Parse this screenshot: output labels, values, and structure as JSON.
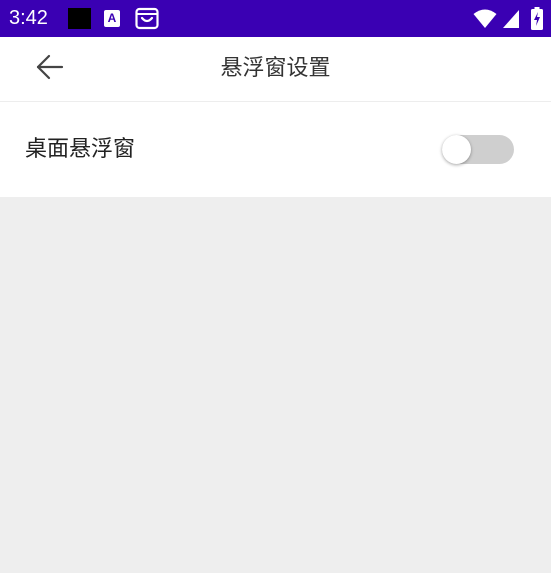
{
  "status_bar": {
    "time": "3:42",
    "background_color": "#3a00b3",
    "icons": [
      "notification-black-icon",
      "a-letter-icon",
      "shopping-bag-icon",
      "wifi-icon",
      "cell-signal-icon",
      "battery-charging-icon"
    ],
    "a_icon_letter": "A"
  },
  "app_bar": {
    "title": "悬浮窗设置",
    "back_icon": "arrow-left-icon"
  },
  "settings": {
    "items": [
      {
        "label": "桌面悬浮窗",
        "toggle_on": false
      }
    ]
  },
  "colors": {
    "content_background": "#eeeeee",
    "toggle_track_off": "#cfcfcf"
  }
}
